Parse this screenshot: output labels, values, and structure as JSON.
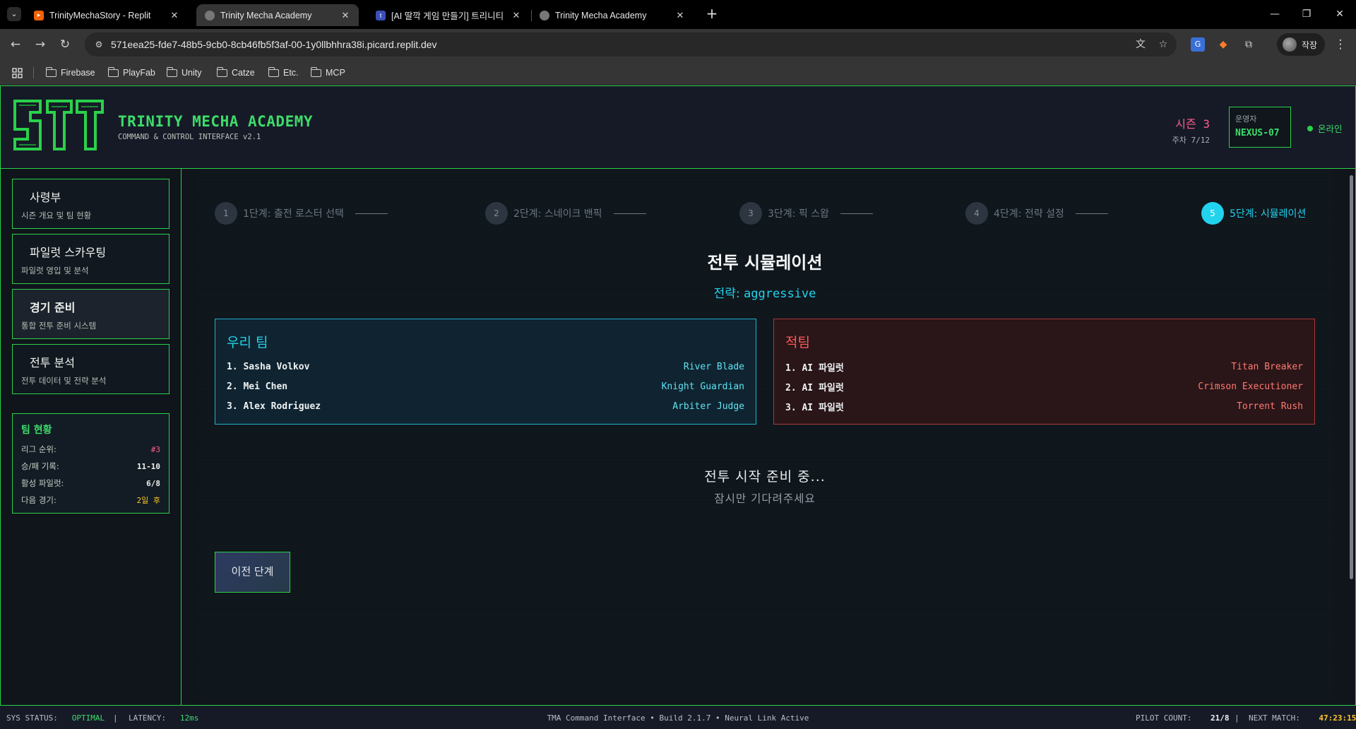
{
  "browser": {
    "tabs": [
      {
        "title": "TrinityMechaStory - Replit",
        "icon": "replit-icon",
        "active": false
      },
      {
        "title": "Trinity Mecha Academy",
        "icon": "globe-icon",
        "active": true
      },
      {
        "title": "[AI 딸깍 게임 만들기] 트리니티",
        "icon": "app-icon",
        "active": false
      },
      {
        "title": "Trinity Mecha Academy",
        "icon": "globe-icon",
        "active": false
      }
    ],
    "url": "571eea25-fde7-48b5-9cb0-8cb46fb5f3af-00-1y0llbhhra38i.picard.replit.dev",
    "profile_name": "작장",
    "bookmarks": [
      "Firebase",
      "PlayFab",
      "Unity",
      "Catze",
      "Etc.",
      "MCP"
    ]
  },
  "header": {
    "title": "TRINITY MECHA ACADEMY",
    "subtitle": "COMMAND & CONTROL INTERFACE v2.1",
    "season": "시즌 3",
    "week": "주차 7/12",
    "operator_label": "운영자",
    "operator_name": "NEXUS-07",
    "status": "온라인"
  },
  "sidebar": {
    "items": [
      {
        "title": "사령부",
        "subtitle": "시즌 개요 및 팀 현황"
      },
      {
        "title": "파일럿 스카우팅",
        "subtitle": "파일럿 영입 및 분석"
      },
      {
        "title": "경기 준비",
        "subtitle": "통합 전투 준비 시스템"
      },
      {
        "title": "전투 분석",
        "subtitle": "전투 데이터 및 전략 분석"
      }
    ],
    "team_status": {
      "title": "팀 현황",
      "rows": [
        {
          "label": "리그 순위:",
          "value": "#3"
        },
        {
          "label": "승/패 기록:",
          "value": "11-10"
        },
        {
          "label": "활성 파일럿:",
          "value": "6/8"
        },
        {
          "label": "다음 경기:",
          "value": "2일 후"
        }
      ]
    }
  },
  "steps": [
    {
      "num": "1",
      "label": "1단계: 출전 로스터 선택"
    },
    {
      "num": "2",
      "label": "2단계: 스네이크 밴픽"
    },
    {
      "num": "3",
      "label": "3단계: 픽 스왑"
    },
    {
      "num": "4",
      "label": "4단계: 전략 설정"
    },
    {
      "num": "5",
      "label": "5단계: 시뮬레이션"
    }
  ],
  "simulation": {
    "title": "전투 시뮬레이션",
    "strategy_label": "전략:",
    "strategy_value": "aggressive",
    "our_team": {
      "title": "우리 팀",
      "pilots": [
        {
          "name": "1. Sasha Volkov",
          "mech": "River Blade"
        },
        {
          "name": "2. Mei Chen",
          "mech": "Knight Guardian"
        },
        {
          "name": "3. Alex Rodriguez",
          "mech": "Arbiter Judge"
        }
      ]
    },
    "enemy_team": {
      "title": "적팀",
      "pilots": [
        {
          "name": "1. AI 파일럿",
          "mech": "Titan Breaker"
        },
        {
          "name": "2. AI 파일럿",
          "mech": "Crimson Executioner"
        },
        {
          "name": "3. AI 파일럿",
          "mech": "Torrent Rush"
        }
      ]
    },
    "prep_title": "전투 시작 준비 중...",
    "prep_subtitle": "잠시만 기다려주세요",
    "prev_button": "이전 단계"
  },
  "statusbar": {
    "sys_label": "SYS STATUS:",
    "sys_value": "OPTIMAL",
    "latency_label": "LATENCY:",
    "latency_value": "12ms",
    "center": "TMA Command Interface • Build 2.1.7 • Neural Link Active",
    "pilot_label": "PILOT COUNT:",
    "pilot_value": "21/8",
    "next_label": "NEXT MATCH:",
    "next_value": "47:23:15"
  },
  "colors": {
    "accent_green": "#2ad14a",
    "accent_cyan": "#22d3ee",
    "enemy_red": "#ff5a5a",
    "pink": "#ff5d8f",
    "yellow": "#ffc629"
  }
}
